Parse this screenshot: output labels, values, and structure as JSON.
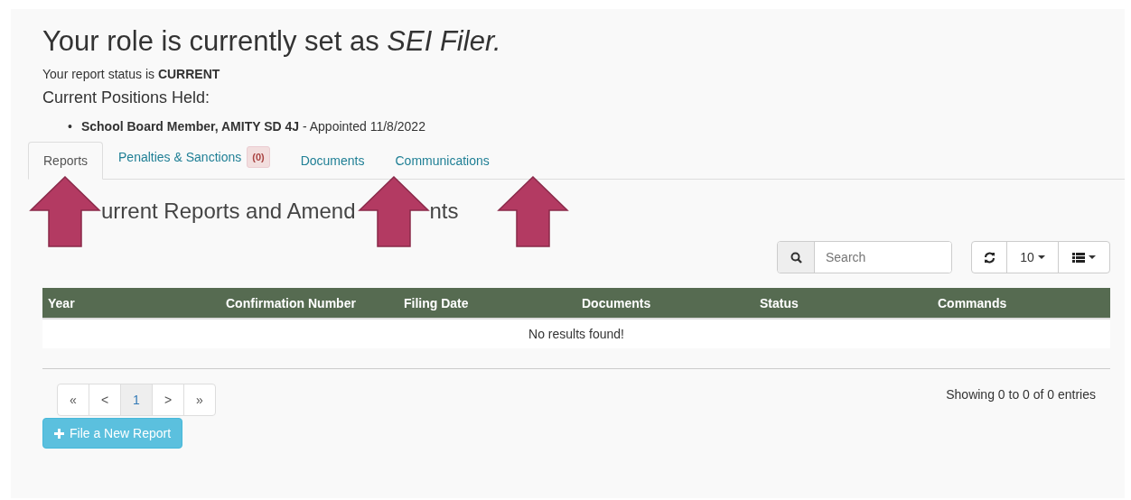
{
  "role_heading": {
    "text": "Your role is currently set as",
    "role": "SEI Filer."
  },
  "status_line": "Your report status is **CURRENT**",
  "positions_heading": "Current Positions Held:",
  "positions": [
    {
      "marker": "•",
      "text": "**School Board Member, AMITY SD 4J** - Appointed 11/8/2022"
    }
  ],
  "tabs": [
    {
      "label": "Reports",
      "selected": true
    },
    {
      "label": "Penalties & Sanctions",
      "selected": false,
      "badge": "(0)"
    },
    {
      "label": "Documents",
      "selected": false
    },
    {
      "label": "Communications",
      "selected": false
    }
  ],
  "section_heading_parts": [
    "urrent Reports and Amend",
    "nts"
  ],
  "search": {
    "placeholder": "Search"
  },
  "page_size": "10",
  "table": {
    "columns": [
      "Year",
      "Confirmation Number",
      "Filing Date",
      "Documents",
      "Status",
      "Commands"
    ],
    "empty_message": "No results found!"
  },
  "pagination": [
    {
      "label": "«",
      "selected": false
    },
    {
      "label": "<",
      "selected": false
    },
    {
      "label": "1",
      "selected": true
    },
    {
      "label": ">",
      "selected": false
    },
    {
      "label": "»",
      "selected": false
    }
  ],
  "summary": "Showing 0 to 0 of 0 entries",
  "new_report_button": "File a New Report",
  "annotations": [
    {
      "kind": "arrow"
    },
    {
      "kind": "arrow"
    },
    {
      "kind": "arrow"
    }
  ]
}
